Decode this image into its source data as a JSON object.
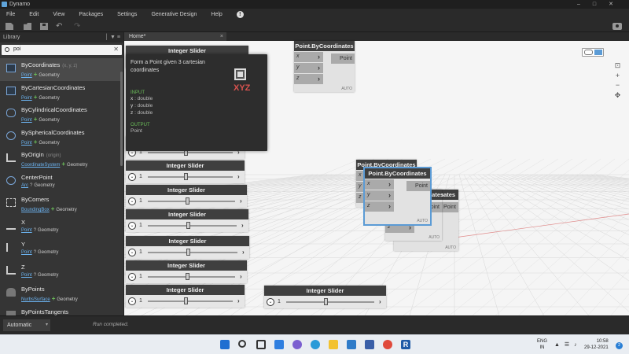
{
  "window": {
    "title": "Dynamo"
  },
  "menu": [
    "File",
    "Edit",
    "View",
    "Packages",
    "Settings",
    "Generative Design",
    "Help"
  ],
  "library": {
    "title": "Library",
    "search_value": "poi",
    "items": [
      {
        "name": "ByCoordinates",
        "params": "(x, y, z)",
        "input": "Point",
        "sep": "+",
        "output": "Geometry",
        "selected": true
      },
      {
        "name": "ByCartesianCoordinates",
        "params": "",
        "input": "Point",
        "sep": "+",
        "output": "Geometry"
      },
      {
        "name": "ByCylindricalCoordinates",
        "params": "",
        "input": "Point",
        "sep": "+",
        "output": "Geometry"
      },
      {
        "name": "BySphericalCoordinates",
        "params": "",
        "input": "Point",
        "sep": "+",
        "output": "Geometry"
      },
      {
        "name": "ByOrigin",
        "params": "(origin)",
        "input": "CoordinateSystem",
        "sep": "+",
        "output": "Geometry"
      },
      {
        "name": "CenterPoint",
        "params": "",
        "input": "Arc",
        "sep": "?",
        "output": "Geometry"
      },
      {
        "name": "ByCorners",
        "params": "",
        "input": "BoundingBox",
        "sep": "+",
        "output": "Geometry"
      },
      {
        "name": "X",
        "params": "",
        "input": "Point",
        "sep": "?",
        "output": "Geometry"
      },
      {
        "name": "Y",
        "params": "",
        "input": "Point",
        "sep": "?",
        "output": "Geometry"
      },
      {
        "name": "Z",
        "params": "",
        "input": "Point",
        "sep": "?",
        "output": "Geometry"
      },
      {
        "name": "ByPoints",
        "params": "",
        "input": "NurbsSurface",
        "sep": "+",
        "output": "Geometry"
      },
      {
        "name": "ByPointsTangents",
        "params": "",
        "input": "",
        "sep": "",
        "output": ""
      }
    ]
  },
  "tab": {
    "label": "Home*",
    "close": "×"
  },
  "tooltip": {
    "description": "Form a Point given 3 cartesian coordinates",
    "icon_text": "XYZ",
    "input_title": "INPUT",
    "inputs": [
      {
        "name": "x",
        "type": ": double"
      },
      {
        "name": "y",
        "type": ": double"
      },
      {
        "name": "z",
        "type": ": double"
      }
    ],
    "output_title": "OUTPUT",
    "output": "Point"
  },
  "nodes": {
    "point_title": "Point.ByCoordinates",
    "output_label": "Point",
    "ports": [
      "x",
      "y",
      "z"
    ],
    "auto_label": "AUTO",
    "slider_title": "Integer Slider",
    "slider_value": "1"
  },
  "statusbar": {
    "exec_mode": "Automatic",
    "status": "Run completed."
  },
  "taskbar": {
    "lang_1": "ENG",
    "lang_2": "IN",
    "time": "10:58",
    "date": "29-12-2021",
    "notifications": "2"
  },
  "colors": {
    "accent": "#6cb3f0",
    "add": "#6cc05a",
    "xyz": "#d9534f",
    "node_header": "#3f3f3f"
  }
}
